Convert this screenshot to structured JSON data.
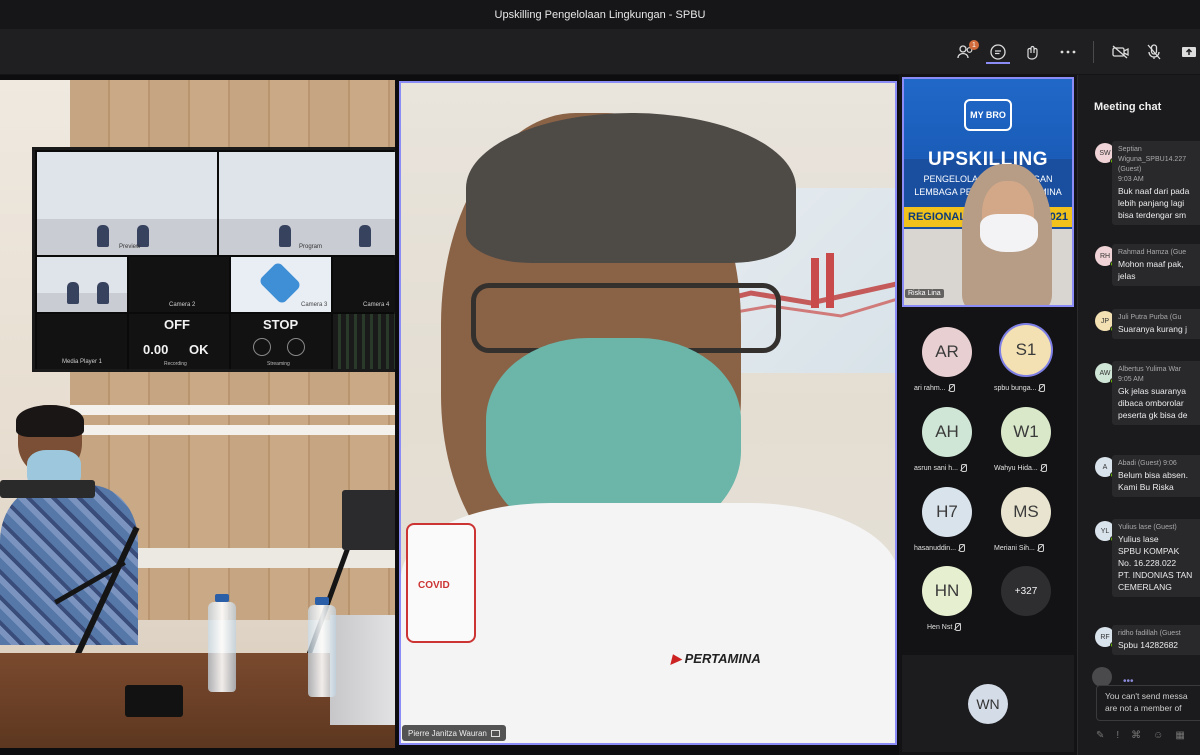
{
  "window": {
    "title": "Upskilling Pengelolaan Lingkungan - SPBU"
  },
  "toolbar": {
    "participants_badge": "1",
    "icons": [
      "participants-icon",
      "chat-icon",
      "reactions-icon",
      "more-icon",
      "camera-off-icon",
      "mic-off-icon",
      "share-icon"
    ]
  },
  "room": {
    "tv": {
      "labels": [
        "Preview",
        "Program",
        "Camera 2",
        "Camera 3",
        "Camera 4",
        "Media Player 1",
        "Recording",
        "Streaming"
      ],
      "off": "OFF",
      "stop": "STOP",
      "time_value": "0.00",
      "ok_value": "OK"
    }
  },
  "speaker": {
    "name": "Pierre Janitza Wauran",
    "shirt_logo": "PERTAMINA",
    "patch_text": "COVID"
  },
  "pinned": {
    "name": "Riska Lina",
    "banner": {
      "brand": "MY BRO",
      "title": "UPSKILLING",
      "subtitle": "PENGELOLAAN LINGKUNGAN",
      "subtitle2": "LEMBAGA PENYALUR PERTAMINA",
      "regional_left": "REGIONAL",
      "regional_right": "T 2021"
    }
  },
  "participants": [
    {
      "initials": "AR",
      "name": "ari rahm...",
      "color": "#e8cfd2",
      "ring": false
    },
    {
      "initials": "S1",
      "name": "spbu bunga...",
      "color": "#f3e1b3",
      "ring": true
    },
    {
      "initials": "AH",
      "name": "asrun sani h...",
      "color": "#cfe6d6",
      "ring": false
    },
    {
      "initials": "W1",
      "name": "Wahyu Hida...",
      "color": "#d8e8c9",
      "ring": false
    },
    {
      "initials": "H7",
      "name": "hasanuddin...",
      "color": "#d9e3ec",
      "ring": false
    },
    {
      "initials": "MS",
      "name": "Meriani Sih...",
      "color": "#e8e4cf",
      "ring": false
    },
    {
      "initials": "HN",
      "name": "Hen Nst",
      "color": "#e6efcf",
      "ring": false
    }
  ],
  "more_participants": "+327",
  "spotlight_avatar": "WN",
  "chat": {
    "title": "Meeting chat",
    "messages": [
      {
        "initials": "SW",
        "color": "#f0d3d6",
        "author": "Septian",
        "author2": "Wiguna_SPBU14.227",
        "guest": "(Guest)",
        "time": "9:03 AM",
        "lines": [
          "Buk naaf dari pada",
          "lebih panjang lagi",
          "bisa terdengar sm"
        ]
      },
      {
        "initials": "RH",
        "color": "#f0d3d6",
        "author": "Rahmad Hamza (Gue",
        "lines": [
          "Mohon maaf pak,",
          "jelas"
        ]
      },
      {
        "initials": "JP",
        "color": "#f3e1b3",
        "author": "Juli Putra Purba (Gu",
        "lines": [
          "Suaranya kurang j"
        ]
      },
      {
        "initials": "AW",
        "color": "#cfe6d6",
        "author": "Albertus Yulima War",
        "time": "9:05 AM",
        "lines": [
          "Gk jelas suaranya",
          "dibaca omborolar",
          "peserta gk bisa de"
        ]
      },
      {
        "initials": "A",
        "color": "#d9e3ec",
        "author": "Abadi (Guest)  9:06",
        "lines": [
          "Belum bisa absen.",
          "Kami Bu Riska"
        ]
      },
      {
        "initials": "YL",
        "color": "#d9e3ec",
        "author": "Yulius lase (Guest)",
        "lines": [
          "Yulius lase",
          "SPBU KOMPAK",
          "No. 16.228.022",
          "PT. INDONIAS TAN",
          "CEMERLANG"
        ]
      },
      {
        "initials": "RF",
        "color": "#d9e3ec",
        "author": "ridho fadillah (Guest",
        "lines": [
          "Spbu 14282682"
        ]
      }
    ],
    "notice_line1": "You can't send messa",
    "notice_line2": "are not a member of"
  }
}
